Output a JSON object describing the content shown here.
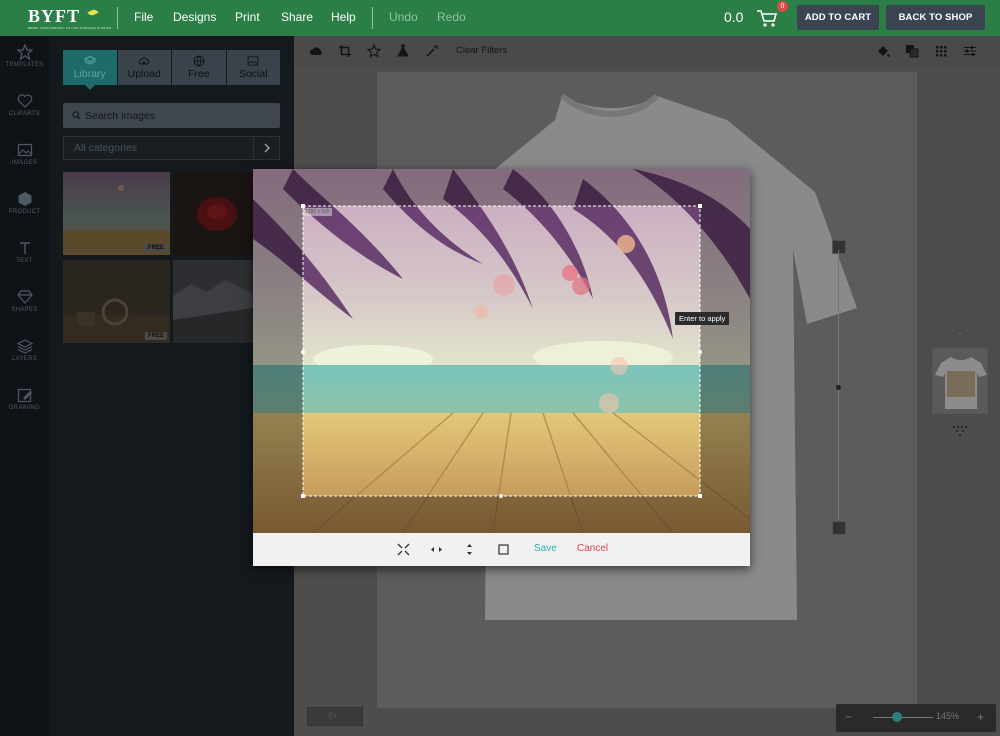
{
  "header": {
    "brand": "BYFT",
    "tagline": "BRING YOUR FANTASY TO LIFE THROUGH CUSTOM",
    "menu": [
      "File",
      "Designs",
      "Print",
      "Share",
      "Help"
    ],
    "undo": "Undo",
    "redo": "Redo",
    "price": "0.0",
    "cart_count": "0",
    "add_to_cart": "ADD TO CART",
    "back_to_shop": "BACK TO SHOP"
  },
  "rail": [
    {
      "label": "TEMPLATES",
      "icon": "star-icon"
    },
    {
      "label": "CLIPARTS",
      "icon": "heart-icon"
    },
    {
      "label": "IMAGES",
      "icon": "image-icon"
    },
    {
      "label": "PRODUCT",
      "icon": "box-icon"
    },
    {
      "label": "TEXT",
      "icon": "text-icon"
    },
    {
      "label": "SHAPES",
      "icon": "diamond-icon"
    },
    {
      "label": "LAYERS",
      "icon": "layers-icon"
    },
    {
      "label": "DRAWING",
      "icon": "pencil-icon"
    }
  ],
  "panel": {
    "tabs": [
      {
        "label": "Library",
        "icon": "layers-icon",
        "active": true
      },
      {
        "label": "Upload",
        "icon": "cloud-upload-icon",
        "active": false
      },
      {
        "label": "Free",
        "icon": "globe-icon",
        "active": false
      },
      {
        "label": "Social",
        "icon": "image-icon",
        "active": false
      }
    ],
    "search_placeholder": "Search images",
    "category": "All categories",
    "free_label": "FREE"
  },
  "toolbar": {
    "clear_filters": "Clear Filters"
  },
  "crop_modal": {
    "size_tag": "1280 x 535",
    "tooltip": "Enter to apply",
    "save": "Save",
    "cancel": "Cancel"
  },
  "zoom": {
    "minus": "−",
    "plus": "+",
    "value": "145%",
    "level_fraction": 0.4
  },
  "page_nav": "8+",
  "colors": {
    "brand_green": "#2a7e46",
    "teal": "#2ab3b1",
    "cancel_red": "#dd4451"
  }
}
